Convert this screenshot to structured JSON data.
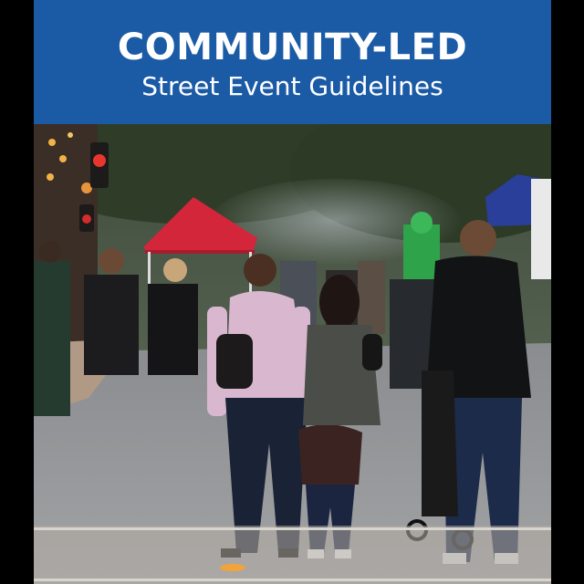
{
  "cover": {
    "title": "COMMUNITY-LED",
    "subtitle": "Street Event Guidelines"
  },
  "colors": {
    "banner": "#1b5ba6",
    "tent": "#d3263b",
    "canopy_blue": "#2a3f9a"
  },
  "photo": {
    "subject": "street-festival-photo"
  }
}
